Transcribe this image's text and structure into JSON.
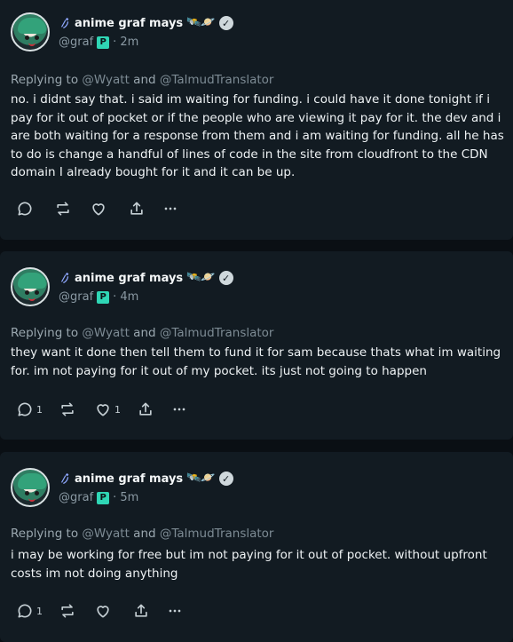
{
  "author": {
    "name": "anime graf mays",
    "emojis": "🛰️🪐",
    "handle": "@graf",
    "badge": "P"
  },
  "reply_prefix": "Replying to",
  "reply_and": "and",
  "mention1": "@Wyatt",
  "mention2": "@TalmudTranslator",
  "posts": [
    {
      "time": "· 2m",
      "text": "no. i didnt say that. i said im waiting for funding. i could have it done tonight if i pay for it out of pocket or if the people who are viewing it  pay for it. the dev and i are both waiting for a response from them and i am waiting for funding. all he has to do is change a handful of lines of code in the site from cloudfront to the CDN domain I already bought for it and it can be up.",
      "reply_count": "",
      "like_count": ""
    },
    {
      "time": "· 4m",
      "text": "they want it done then tell them to fund it for sam because thats what im waiting for. im not paying for it out of my pocket. its just not going to happen",
      "reply_count": "1",
      "like_count": "1"
    },
    {
      "time": "· 5m",
      "text": "i may be working for free but im not paying for it out of pocket. without upfront costs im not doing anything",
      "reply_count": "1",
      "like_count": ""
    }
  ],
  "verified_mark": "✓"
}
